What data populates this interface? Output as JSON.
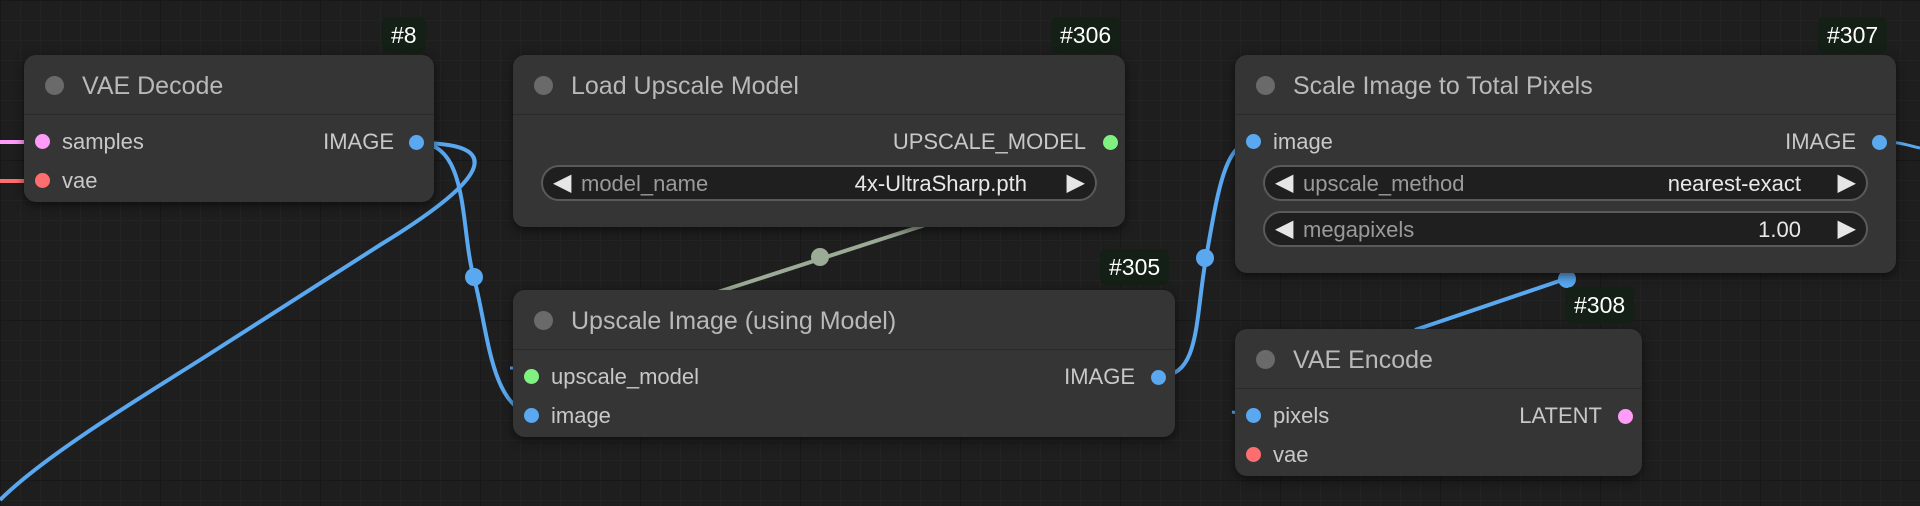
{
  "colors": {
    "image": "#5aa8f0",
    "latent": "#ff9cf9",
    "vae": "#ff6e6e",
    "upscale_model": "#80f080",
    "upscale_link": "#9bab95",
    "node_bg": "#353535",
    "canvas_bg": "#1e1e1e"
  },
  "nodes": {
    "vae_decode": {
      "id": "#8",
      "title": "VAE Decode",
      "inputs": [
        "samples",
        "vae"
      ],
      "output": "IMAGE"
    },
    "load_upscale_model": {
      "id": "#306",
      "title": "Load Upscale Model",
      "output": "UPSCALE_MODEL",
      "widget": {
        "name": "model_name",
        "value": "4x-UltraSharp.pth"
      }
    },
    "upscale_image": {
      "id": "#305",
      "title": "Upscale Image (using Model)",
      "inputs": [
        "upscale_model",
        "image"
      ],
      "output": "IMAGE"
    },
    "scale_image": {
      "id": "#307",
      "title": "Scale Image to Total Pixels",
      "input": "image",
      "output": "IMAGE",
      "widgets": [
        {
          "name": "upscale_method",
          "value": "nearest-exact"
        },
        {
          "name": "megapixels",
          "value": "1.00"
        }
      ]
    },
    "vae_encode": {
      "id": "#308",
      "title": "VAE Encode",
      "inputs": [
        "pixels",
        "vae"
      ],
      "output": "LATENT"
    }
  },
  "icons": {
    "left_arrow": "◀",
    "right_arrow": "▶"
  }
}
